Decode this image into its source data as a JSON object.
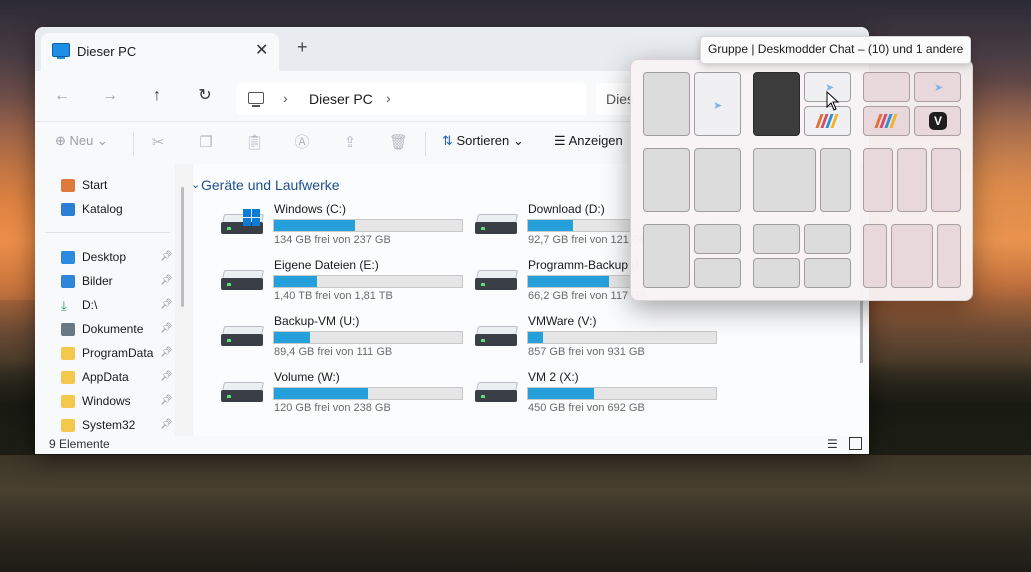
{
  "window": {
    "tab_title": "Dieser PC",
    "close_glyph": "✕",
    "add_glyph": "+",
    "breadcrumb": "Dieser PC",
    "search_placeholder": "Dies"
  },
  "toolbar": {
    "new_label": "Neu",
    "sort_label": "Sortieren",
    "view_label": "Anzeigen"
  },
  "sidebar": {
    "items": [
      {
        "label": "Start",
        "icon": "home-icon"
      },
      {
        "label": "Katalog",
        "icon": "gallery-icon"
      },
      {
        "label": "Desktop",
        "icon": "desktop-icon",
        "pinned": true
      },
      {
        "label": "Bilder",
        "icon": "pictures-icon",
        "pinned": true
      },
      {
        "label": "D:\\",
        "icon": "download-drive-icon",
        "pinned": true
      },
      {
        "label": "Dokumente",
        "icon": "documents-icon",
        "pinned": true
      },
      {
        "label": "ProgramData",
        "icon": "folder-icon",
        "pinned": true
      },
      {
        "label": "AppData",
        "icon": "folder-icon",
        "pinned": true
      },
      {
        "label": "Windows",
        "icon": "folder-icon",
        "pinned": true
      },
      {
        "label": "System32",
        "icon": "folder-icon",
        "pinned": true
      }
    ]
  },
  "main": {
    "group_title": "Geräte und Laufwerke",
    "drives": [
      {
        "name": "Windows (C:)",
        "free": "134 GB frei von 237 GB",
        "used_fraction": 0.43
      },
      {
        "name": "Download (D:)",
        "free": "92,7 GB frei von 121 GB",
        "used_fraction": 0.24
      },
      {
        "name": "Eigene Dateien (E:)",
        "free": "1,40 TB frei von 1,81 TB",
        "used_fraction": 0.23
      },
      {
        "name": "Programm-Backup (I",
        "free": "66,2 GB frei von 117 GB",
        "used_fraction": 0.43
      },
      {
        "name": "Backup-VM (U:)",
        "free": "89,4 GB frei von 111 GB",
        "used_fraction": 0.19
      },
      {
        "name": "VMWare (V:)",
        "free": "857 GB frei von 931 GB",
        "used_fraction": 0.08
      },
      {
        "name": "Volume (W:)",
        "free": "120 GB frei von 238 GB",
        "used_fraction": 0.5
      },
      {
        "name": "VM 2 (X:)",
        "free": "450 GB frei von 692 GB",
        "used_fraction": 0.35
      }
    ]
  },
  "status": {
    "count": "9 Elemente"
  },
  "snap": {
    "tooltip": "Gruppe | Deskmodder Chat – (10) und 1 andere"
  },
  "colors": {
    "accent": "#26a0da",
    "title_blue": "#1d4f91"
  }
}
